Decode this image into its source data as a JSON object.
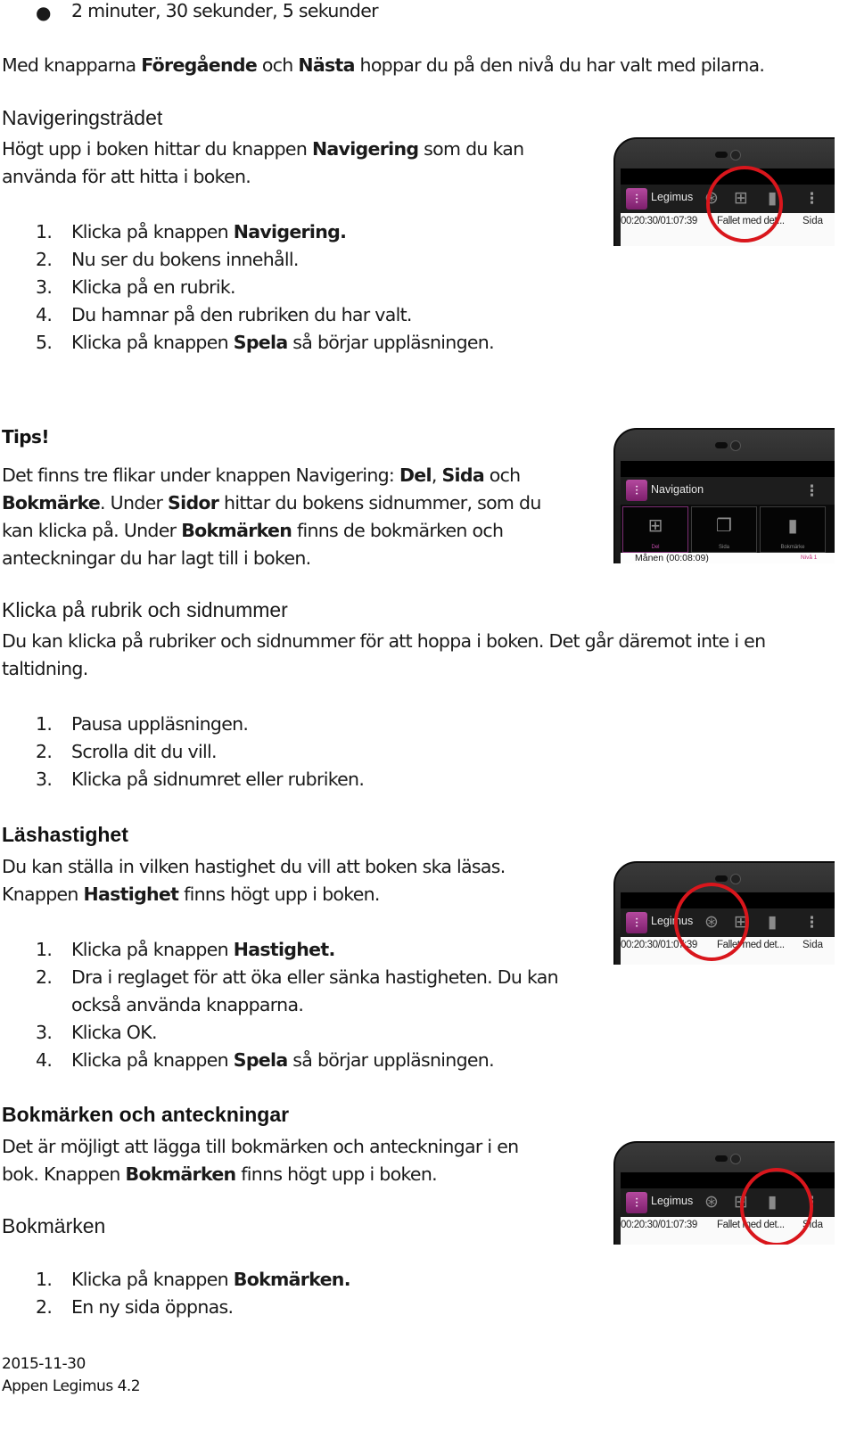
{
  "document": {
    "bullet_item": "2 minuter, 30 sekunder, 5 sekunder",
    "intro_paragraph": {
      "pre": "Med knapparna ",
      "bold1": "Föregående",
      "mid": " och ",
      "bold2": "Nästa",
      "post": " hoppar du på den nivå du har valt med pilarna."
    },
    "section_nav_tree": {
      "heading": "Navigeringsträdet",
      "para_pre": "Högt upp i boken hittar du knappen ",
      "para_bold": "Navigering",
      "para_post": " som du kan",
      "para_line2": "använda för att hitta i boken.",
      "steps": [
        {
          "num": "1.",
          "pre": "Klicka på knappen ",
          "bold": "Navigering.",
          "post": ""
        },
        {
          "num": "2.",
          "pre": "Nu ser du bokens innehåll.",
          "bold": "",
          "post": ""
        },
        {
          "num": "3.",
          "pre": "Klicka på en rubrik.",
          "bold": "",
          "post": ""
        },
        {
          "num": "4.",
          "pre": "Du hamnar på den rubriken du har valt.",
          "bold": "",
          "post": ""
        },
        {
          "num": "5.",
          "pre": "Klicka på knappen ",
          "bold": "Spela",
          "post": " så börjar uppläsningen."
        }
      ]
    },
    "tips": {
      "heading": "Tips!",
      "l1_pre": "Det finns tre flikar under knappen Navigering: ",
      "l1_b1": "Del",
      "l1_sep": ", ",
      "l1_b2": "Sida",
      "l1_post": " och",
      "l2_b1": "Bokmärke",
      "l2_mid": ". Under ",
      "l2_b2": "Sidor",
      "l2_post": " hittar du bokens sidnummer, som du",
      "l3_pre": "kan klicka på. Under ",
      "l3_b": "Bokmärken",
      "l3_post": " finns de bokmärken och",
      "l4": "anteckningar du har lagt till i boken."
    },
    "section_click": {
      "heading": "Klicka på rubrik och sidnummer",
      "line1": "Du kan klicka på rubriker och sidnummer för att hoppa i boken. Det går däremot inte i en",
      "line2": "taltidning.",
      "steps": [
        {
          "num": "1.",
          "text": "Pausa uppläsningen."
        },
        {
          "num": "2.",
          "text": "Scrolla dit du vill."
        },
        {
          "num": "3.",
          "text": "Klicka på sidnumret eller rubriken."
        }
      ]
    },
    "section_speed": {
      "heading": "Läshastighet",
      "line1": "Du kan ställa in vilken hastighet du vill att boken ska läsas.",
      "line2_pre": "Knappen ",
      "line2_bold": "Hastighet",
      "line2_post": " finns högt upp i boken.",
      "steps": [
        {
          "num": "1.",
          "pre": "Klicka på knappen ",
          "bold": "Hastighet.",
          "post": "",
          "cont": ""
        },
        {
          "num": "2.",
          "pre": "Dra i reglaget för att öka eller sänka hastigheten. Du kan",
          "bold": "",
          "post": "",
          "cont": "också använda knapparna."
        },
        {
          "num": "3.",
          "pre": "Klicka OK.",
          "bold": "",
          "post": "",
          "cont": ""
        },
        {
          "num": "4.",
          "pre": "Klicka på knappen ",
          "bold": "Spela",
          "post": " så börjar uppläsningen.",
          "cont": ""
        }
      ]
    },
    "section_bookmarks": {
      "heading": "Bokmärken och anteckningar",
      "line1": "Det är möjligt att lägga till bokmärken och anteckningar i en",
      "line2_pre": "bok. Knappen ",
      "line2_bold": "Bokmärken",
      "line2_post": " finns högt upp i boken.",
      "subheading": "Bokmärken",
      "steps": [
        {
          "num": "1.",
          "pre": "Klicka på knappen ",
          "bold": "Bokmärken.",
          "post": ""
        },
        {
          "num": "2.",
          "pre": "En ny sida öppnas.",
          "bold": "",
          "post": ""
        }
      ]
    },
    "footer": {
      "date": "2015-11-30",
      "app_version": "Appen Legimus 4.2"
    }
  },
  "screenshots": {
    "player_bar": {
      "app_title": "Legimus",
      "time": "00:20:30/01:07:39",
      "chapter": "Fallet med det...",
      "page_label": "Sida",
      "icons": [
        "speed-icon",
        "navigation-tree-icon",
        "bookmark-add-icon",
        "overflow-menu-icon"
      ]
    },
    "navigation_view": {
      "app_title": "Navigation",
      "tabs": [
        {
          "label": "Del",
          "icon": "tree-icon",
          "active": true
        },
        {
          "label": "Sida",
          "icon": "page-icon",
          "active": false
        },
        {
          "label": "Bokmärke",
          "icon": "bookmarks-icon",
          "active": false
        }
      ],
      "row_text": "Månen (00:08:09)",
      "row_right": "Nivå 1"
    },
    "highlight_color": "#d9161c",
    "brand_color": "#9b3389"
  }
}
